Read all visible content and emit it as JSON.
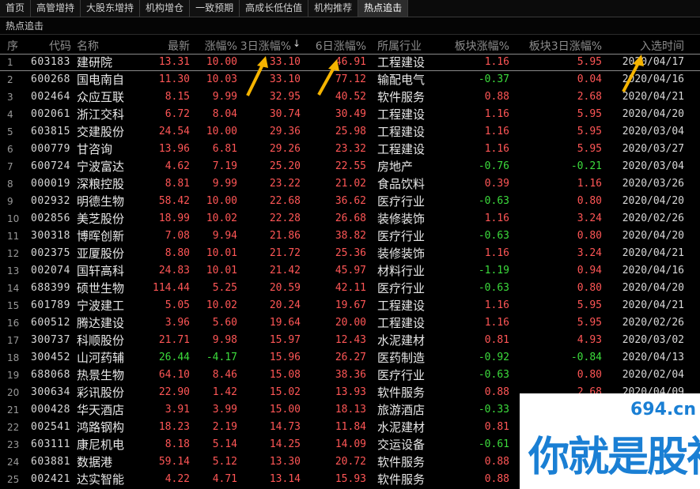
{
  "tabs": [
    "首页",
    "高管增持",
    "大股东增持",
    "机构增仓",
    "一致预期",
    "高成长低估值",
    "机构推荐",
    "热点追击"
  ],
  "active_tab_index": 7,
  "subheader": "热点追击",
  "columns": {
    "idx": "序",
    "code": "代码",
    "name": "名称",
    "price": "最新",
    "chg": "涨幅%",
    "chg3": "3日涨幅%",
    "chg6": "6日涨幅%",
    "industry": "所属行业",
    "block_chg": "板块涨幅%",
    "block_chg3": "板块3日涨幅%",
    "date": "入选时间",
    "sort_icon": "↓"
  },
  "colors": {
    "up": "#ff5656",
    "down": "#3cdb3c",
    "arrow": "#f5b400",
    "watermark": "#1a7fd4"
  },
  "rows": [
    {
      "idx": "1",
      "code": "603183",
      "name": "建研院",
      "price": "13.31",
      "chg": "10.00",
      "chg3": "33.10",
      "chg6": "46.91",
      "industry": "工程建设",
      "bchg": "1.16",
      "bchg3": "5.95",
      "date": "2020/04/17"
    },
    {
      "idx": "2",
      "code": "600268",
      "name": "国电南自",
      "price": "11.30",
      "chg": "10.03",
      "chg3": "33.10",
      "chg6": "77.12",
      "industry": "输配电气",
      "bchg": "-0.37",
      "bchg3": "0.04",
      "date": "2020/04/16"
    },
    {
      "idx": "3",
      "code": "002464",
      "name": "众应互联",
      "price": "8.15",
      "chg": "9.99",
      "chg3": "32.95",
      "chg6": "40.52",
      "industry": "软件服务",
      "bchg": "0.88",
      "bchg3": "2.68",
      "date": "2020/04/21"
    },
    {
      "idx": "4",
      "code": "002061",
      "name": "浙江交科",
      "price": "6.72",
      "chg": "8.04",
      "chg3": "30.74",
      "chg6": "30.49",
      "industry": "工程建设",
      "bchg": "1.16",
      "bchg3": "5.95",
      "date": "2020/04/20"
    },
    {
      "idx": "5",
      "code": "603815",
      "name": "交建股份",
      "price": "24.54",
      "chg": "10.00",
      "chg3": "29.36",
      "chg6": "25.98",
      "industry": "工程建设",
      "bchg": "1.16",
      "bchg3": "5.95",
      "date": "2020/03/04"
    },
    {
      "idx": "6",
      "code": "000779",
      "name": "甘咨询",
      "price": "13.96",
      "chg": "6.81",
      "chg3": "29.26",
      "chg6": "23.32",
      "industry": "工程建设",
      "bchg": "1.16",
      "bchg3": "5.95",
      "date": "2020/03/27"
    },
    {
      "idx": "7",
      "code": "600724",
      "name": "宁波富达",
      "price": "4.62",
      "chg": "7.19",
      "chg3": "25.20",
      "chg6": "22.55",
      "industry": "房地产",
      "bchg": "-0.76",
      "bchg3": "-0.21",
      "date": "2020/03/04"
    },
    {
      "idx": "8",
      "code": "000019",
      "name": "深粮控股",
      "price": "8.81",
      "chg": "9.99",
      "chg3": "23.22",
      "chg6": "21.02",
      "industry": "食品饮料",
      "bchg": "0.39",
      "bchg3": "1.16",
      "date": "2020/03/26"
    },
    {
      "idx": "9",
      "code": "002932",
      "name": "明德生物",
      "price": "58.42",
      "chg": "10.00",
      "chg3": "22.68",
      "chg6": "36.62",
      "industry": "医疗行业",
      "bchg": "-0.63",
      "bchg3": "0.80",
      "date": "2020/04/20"
    },
    {
      "idx": "10",
      "code": "002856",
      "name": "美芝股份",
      "price": "18.99",
      "chg": "10.02",
      "chg3": "22.28",
      "chg6": "26.68",
      "industry": "装修装饰",
      "bchg": "1.16",
      "bchg3": "3.24",
      "date": "2020/02/26"
    },
    {
      "idx": "11",
      "code": "300318",
      "name": "博晖创新",
      "price": "7.08",
      "chg": "9.94",
      "chg3": "21.86",
      "chg6": "38.82",
      "industry": "医疗行业",
      "bchg": "-0.63",
      "bchg3": "0.80",
      "date": "2020/04/20"
    },
    {
      "idx": "12",
      "code": "002375",
      "name": "亚厦股份",
      "price": "8.80",
      "chg": "10.01",
      "chg3": "21.72",
      "chg6": "25.36",
      "industry": "装修装饰",
      "bchg": "1.16",
      "bchg3": "3.24",
      "date": "2020/04/21"
    },
    {
      "idx": "13",
      "code": "002074",
      "name": "国轩高科",
      "price": "24.83",
      "chg": "10.01",
      "chg3": "21.42",
      "chg6": "45.97",
      "industry": "材料行业",
      "bchg": "-1.19",
      "bchg3": "0.94",
      "date": "2020/04/16"
    },
    {
      "idx": "14",
      "code": "688399",
      "name": "硕世生物",
      "price": "114.44",
      "chg": "5.25",
      "chg3": "20.59",
      "chg6": "42.11",
      "industry": "医疗行业",
      "bchg": "-0.63",
      "bchg3": "0.80",
      "date": "2020/04/20"
    },
    {
      "idx": "15",
      "code": "601789",
      "name": "宁波建工",
      "price": "5.05",
      "chg": "10.02",
      "chg3": "20.24",
      "chg6": "19.67",
      "industry": "工程建设",
      "bchg": "1.16",
      "bchg3": "5.95",
      "date": "2020/04/21"
    },
    {
      "idx": "16",
      "code": "600512",
      "name": "腾达建设",
      "price": "3.96",
      "chg": "5.60",
      "chg3": "19.64",
      "chg6": "20.00",
      "industry": "工程建设",
      "bchg": "1.16",
      "bchg3": "5.95",
      "date": "2020/02/26"
    },
    {
      "idx": "17",
      "code": "300737",
      "name": "科顺股份",
      "price": "21.71",
      "chg": "9.98",
      "chg3": "15.97",
      "chg6": "12.43",
      "industry": "水泥建材",
      "bchg": "0.81",
      "bchg3": "4.93",
      "date": "2020/03/02"
    },
    {
      "idx": "18",
      "code": "300452",
      "name": "山河药辅",
      "price": "26.44",
      "chg": "-4.17",
      "chg3": "15.96",
      "chg6": "26.27",
      "industry": "医药制造",
      "bchg": "-0.92",
      "bchg3": "-0.84",
      "date": "2020/04/13"
    },
    {
      "idx": "19",
      "code": "688068",
      "name": "热景生物",
      "price": "64.10",
      "chg": "8.46",
      "chg3": "15.08",
      "chg6": "38.36",
      "industry": "医疗行业",
      "bchg": "-0.63",
      "bchg3": "0.80",
      "date": "2020/02/04"
    },
    {
      "idx": "20",
      "code": "300634",
      "name": "彩讯股份",
      "price": "22.90",
      "chg": "1.42",
      "chg3": "15.02",
      "chg6": "13.93",
      "industry": "软件服务",
      "bchg": "0.88",
      "bchg3": "2.68",
      "date": "2020/04/09"
    },
    {
      "idx": "21",
      "code": "000428",
      "name": "华天酒店",
      "price": "3.91",
      "chg": "3.99",
      "chg3": "15.00",
      "chg6": "18.13",
      "industry": "旅游酒店",
      "bchg": "-0.33",
      "bchg3": "",
      "date": ""
    },
    {
      "idx": "22",
      "code": "002541",
      "name": "鸿路钢构",
      "price": "18.23",
      "chg": "2.19",
      "chg3": "14.73",
      "chg6": "11.84",
      "industry": "水泥建材",
      "bchg": "0.81",
      "bchg3": "",
      "date": ""
    },
    {
      "idx": "23",
      "code": "603111",
      "name": "康尼机电",
      "price": "8.18",
      "chg": "5.14",
      "chg3": "14.25",
      "chg6": "14.09",
      "industry": "交运设备",
      "bchg": "-0.61",
      "bchg3": "",
      "date": ""
    },
    {
      "idx": "24",
      "code": "603881",
      "name": "数据港",
      "price": "59.14",
      "chg": "5.12",
      "chg3": "13.30",
      "chg6": "20.72",
      "industry": "软件服务",
      "bchg": "0.88",
      "bchg3": "",
      "date": ""
    },
    {
      "idx": "25",
      "code": "002421",
      "name": "达实智能",
      "price": "4.22",
      "chg": "4.71",
      "chg3": "13.14",
      "chg6": "15.93",
      "industry": "软件服务",
      "bchg": "0.88",
      "bchg3": "",
      "date": ""
    }
  ],
  "watermark": {
    "url": "694.cn",
    "slogan": "你就是股神"
  }
}
